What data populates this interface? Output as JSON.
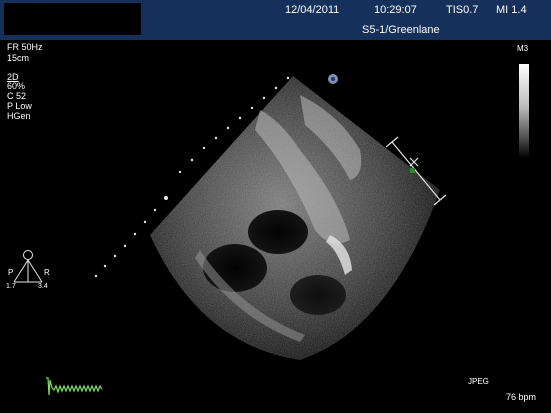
{
  "header": {
    "date": "12/04/2011",
    "time": "10:29:07",
    "tis": "TIS0.7",
    "mi": "MI 1.4",
    "probe": "S5-1/Greenlane"
  },
  "params": {
    "frame_rate": "FR 50Hz",
    "depth": "15cm",
    "mode": "2D",
    "gain": " 60%",
    "compress": "C 52",
    "power": "P Low",
    "harmonic": "HGen"
  },
  "map_label": "M3",
  "orientation": {
    "posterior": "P",
    "right": "R",
    "left_value": "1.7",
    "right_value": "3.4"
  },
  "format_label": "JPEG",
  "heart_rate": "76 bpm",
  "colors": {
    "header_bg": "#15305a",
    "ecg_trace": "#7fe05a",
    "marker_green": "#2a8a2a"
  },
  "icons": [
    "probe-orientation-icon",
    "depth-marker-dots",
    "caliper-icon",
    "ecg-trace"
  ]
}
